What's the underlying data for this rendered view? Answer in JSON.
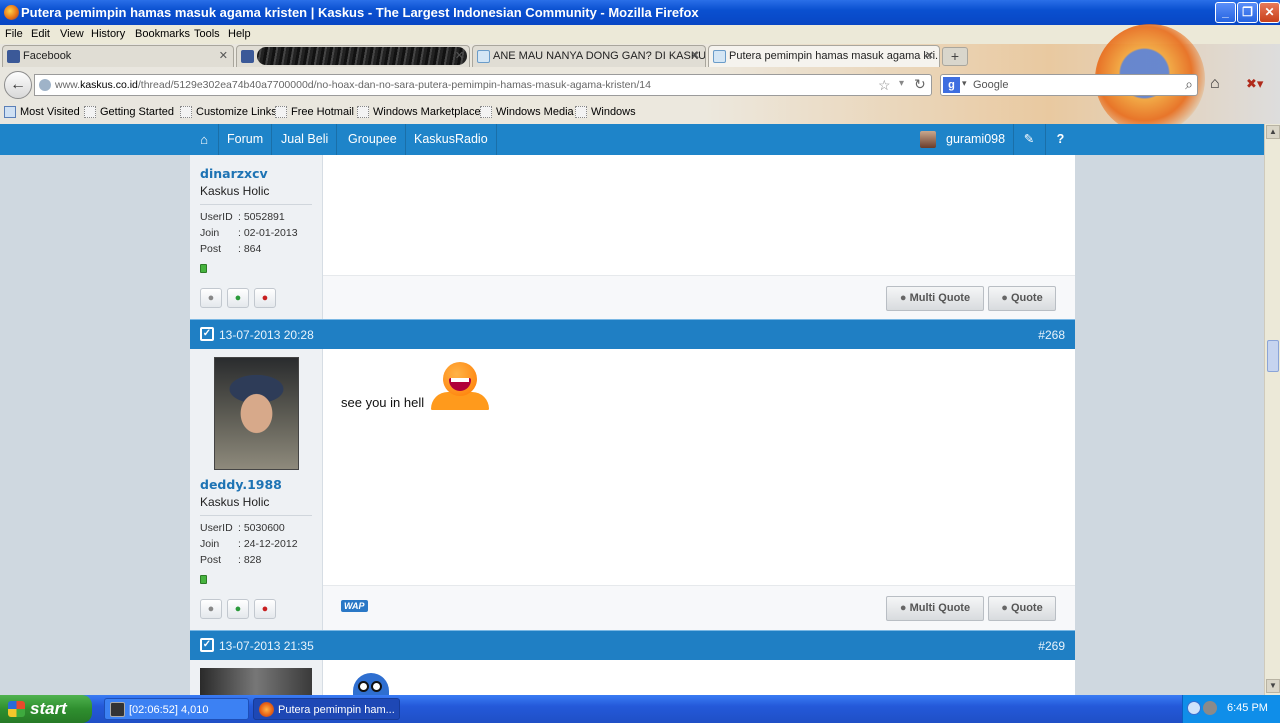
{
  "window": {
    "title": "Putera pemimpin hamas masuk agama kristen | Kaskus - The Largest Indonesian Community - Mozilla Firefox",
    "minimize": "_",
    "restore": "❐",
    "close": "✕"
  },
  "menu": [
    "File",
    "Edit",
    "View",
    "History",
    "Bookmarks",
    "Tools",
    "Help"
  ],
  "tabs": [
    {
      "label": "Facebook",
      "icon": "facebook-icon",
      "active": false
    },
    {
      "label": "",
      "icon": "facebook-icon",
      "active": false,
      "redacted": true
    },
    {
      "label": "ANE MAU NANYA DONG GAN? DI KASKUS...",
      "icon": "kaskus-icon",
      "active": false
    },
    {
      "label": "Putera pemimpin hamas masuk agama kri...",
      "icon": "kaskus-icon",
      "active": true
    }
  ],
  "tab_close": "✕",
  "new_tab": "+",
  "address": {
    "prefix": "www.",
    "domain": "kaskus.co.id",
    "path": "/thread/5129e302ea74b40a7700000d/no-hoax-dan-no-sara-putera-pemimpin-hamas-masuk-agama-kristen/14"
  },
  "search": {
    "engine": "g",
    "placeholder": "Google"
  },
  "bookmarks": [
    "Most Visited",
    "Getting Started",
    "Customize Links",
    "Free Hotmail",
    "Windows Marketplace",
    "Windows Media",
    "Windows"
  ],
  "kaskus_nav": {
    "items": [
      "Forum",
      "Jual Beli",
      "Groupee",
      "KaskusRadio"
    ],
    "username": "gurami098",
    "edit_icon": "✎",
    "help_icon": "?"
  },
  "posts": [
    {
      "username": "dinarzxcv",
      "rank": "Kaskus Holic",
      "userid_label": "UserID",
      "userid": ": 5052891",
      "join_label": "Join",
      "join": ": 02-01-2013",
      "post_label": "Post",
      "post": ": 864",
      "multi_quote": "Multi Quote",
      "quote": "Quote"
    },
    {
      "date": "13-07-2013 20:28",
      "number": "#268",
      "username": "deddy.1988",
      "rank": "Kaskus Holic",
      "userid_label": "UserID",
      "userid": ": 5030600",
      "join_label": "Join",
      "join": ": 24-12-2012",
      "post_label": "Post",
      "post": ": 828",
      "message": "see you in hell",
      "wap": "WAP",
      "multi_quote": "Multi Quote",
      "quote": "Quote"
    },
    {
      "date": "13-07-2013 21:35",
      "number": "#269"
    }
  ],
  "taskbar": {
    "start": "start",
    "items": [
      "[02:06:52] 4,010",
      "Putera pemimpin ham..."
    ],
    "clock": "6:45 PM"
  },
  "colors": {
    "kaskus_blue": "#1e84c9",
    "username_blue": "#1d73b4",
    "xp_taskbar": "#2459d9",
    "online_green": "#46b33e"
  }
}
